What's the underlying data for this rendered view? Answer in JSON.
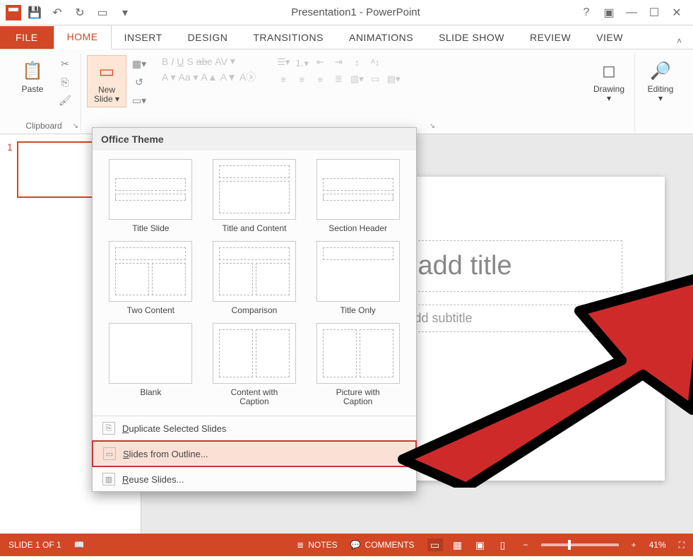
{
  "window": {
    "title": "Presentation1 - PowerPoint"
  },
  "tabs": {
    "file": "FILE",
    "home": "HOME",
    "insert": "INSERT",
    "design": "DESIGN",
    "transitions": "TRANSITIONS",
    "animations": "ANIMATIONS",
    "slideshow": "SLIDE SHOW",
    "review": "REVIEW",
    "view": "VIEW"
  },
  "ribbon": {
    "paste": "Paste",
    "clipboard": "Clipboard",
    "new_slide": "New\nSlide ▾",
    "drawing": "Drawing",
    "editing": "Editing",
    "drawing_arrow": "▾",
    "editing_arrow": "▾",
    "bold": "B",
    "italic": "I",
    "underline": "U",
    "shadow": "S",
    "strike": "abc",
    "spacing": "AV",
    "fontface": "A ▾",
    "fontsize": "Aa ▾",
    "inc": "A▲",
    "dec": "A▼",
    "clear": "Aⓐ"
  },
  "gallery": {
    "header": "Office Theme",
    "layouts": [
      "Title Slide",
      "Title and Content",
      "Section Header",
      "Two Content",
      "Comparison",
      "Title Only",
      "Blank",
      "Content with\nCaption",
      "Picture with\nCaption"
    ],
    "cmd_duplicate": "Duplicate Selected Slides",
    "cmd_outline": "Slides from Outline...",
    "cmd_reuse": "Reuse Slides...",
    "dup_key": "D",
    "outline_key": "S",
    "reuse_key": "R"
  },
  "slide": {
    "title_placeholder": "Click to add title",
    "subtitle_placeholder": "Click to add subtitle"
  },
  "thumb": {
    "num": "1"
  },
  "status": {
    "slide_of": "SLIDE 1 OF 1",
    "notes": "NOTES",
    "comments": "COMMENTS",
    "zoom": "41%"
  }
}
